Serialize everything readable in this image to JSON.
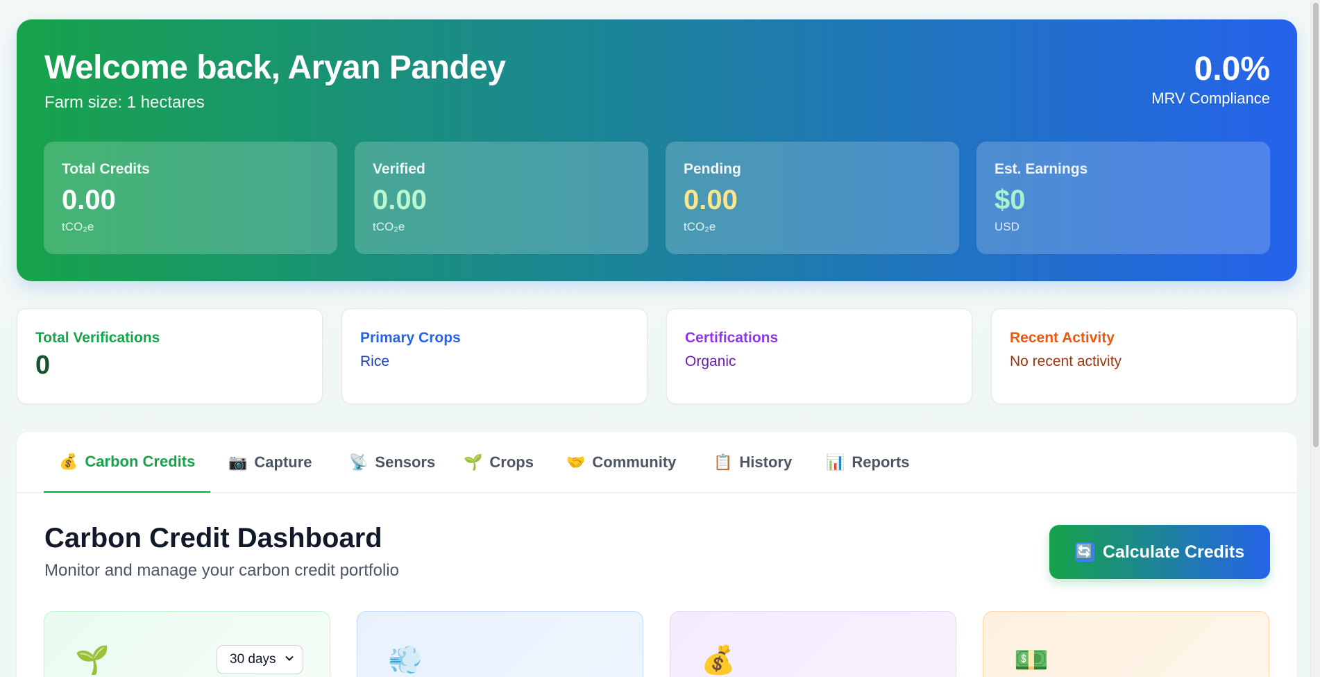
{
  "hero": {
    "title": "Welcome back, Aryan Pandey",
    "subtitle": "Farm size: 1 hectares",
    "mrv_value": "0.0%",
    "mrv_label": "MRV Compliance",
    "stats": [
      {
        "label": "Total Credits",
        "value": "0.00",
        "unit": "tCO₂e",
        "color": "#ffffff"
      },
      {
        "label": "Verified",
        "value": "0.00",
        "unit": "tCO₂e",
        "color": "#bbf7d0"
      },
      {
        "label": "Pending",
        "value": "0.00",
        "unit": "tCO₂e",
        "color": "#fde68a"
      },
      {
        "label": "Est. Earnings",
        "value": "$0",
        "unit": "USD",
        "color": "#a7f3d0"
      }
    ]
  },
  "info_cards": [
    {
      "title": "Total Verifications",
      "value": "0",
      "title_color": "#16a34a",
      "value_color": "#14532d"
    },
    {
      "title": "Primary Crops",
      "value": "Rice",
      "title_color": "#2563eb",
      "value_color": "#1e40af"
    },
    {
      "title": "Certifications",
      "value": "Organic",
      "title_color": "#9333ea",
      "value_color": "#6b21a8"
    },
    {
      "title": "Recent Activity",
      "value": "No recent activity",
      "title_color": "#ea580c",
      "value_color": "#9a3412"
    }
  ],
  "tabs": [
    {
      "icon": "💰",
      "icon_name": "money-bag-icon",
      "label": "Carbon Credits",
      "active": true
    },
    {
      "icon": "📷",
      "icon_name": "camera-icon",
      "label": "Capture"
    },
    {
      "icon": "📡",
      "icon_name": "satellite-antenna-icon",
      "label": "Sensors"
    },
    {
      "icon": "🌱",
      "icon_name": "seedling-icon",
      "label": "Crops"
    },
    {
      "icon": "🤝",
      "icon_name": "handshake-icon",
      "label": "Community"
    },
    {
      "icon": "📋",
      "icon_name": "clipboard-icon",
      "label": "History"
    },
    {
      "icon": "📊",
      "icon_name": "bar-chart-icon",
      "label": "Reports"
    }
  ],
  "dashboard": {
    "title": "Carbon Credit Dashboard",
    "subtitle": "Monitor and manage your carbon credit portfolio",
    "calc_icon": "🔄",
    "calc_label": "Calculate Credits",
    "range_value": "30 days"
  },
  "metric_icons": [
    {
      "icon": "🌱",
      "name": "seedling-icon"
    },
    {
      "icon": "💨",
      "name": "wind-cloud-icon"
    },
    {
      "icon": "💰",
      "name": "money-bag-icon"
    },
    {
      "icon": "💵",
      "name": "banknote-icon"
    }
  ]
}
